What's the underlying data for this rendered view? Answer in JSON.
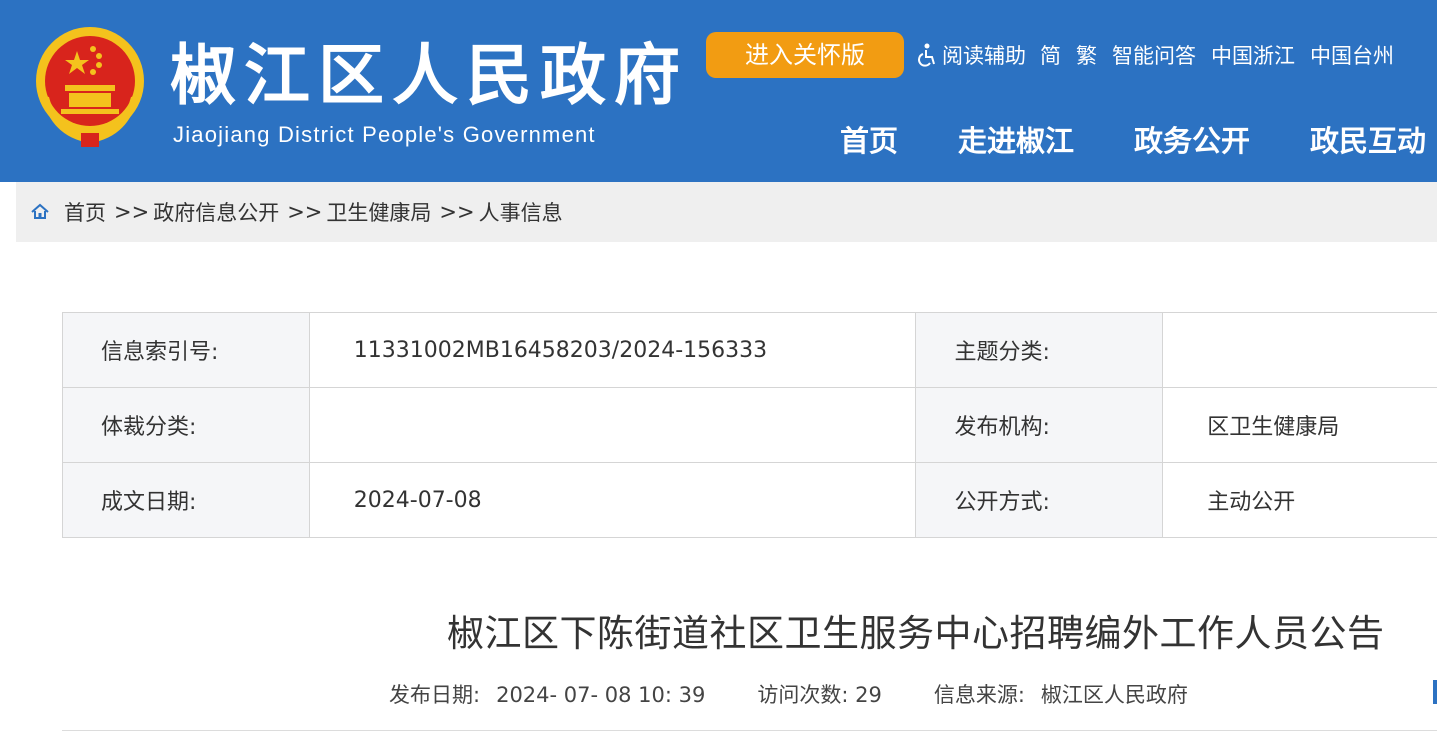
{
  "header": {
    "site_title": "椒江区人民政府",
    "site_subtitle": "Jiaojiang District People's Government",
    "care_button": "进入关怀版",
    "top_links": {
      "reading_aid": "阅读辅助",
      "simplified": "简",
      "traditional": "繁",
      "smart_qa": "智能问答",
      "china_zhejiang": "中国浙江",
      "china_taizhou": "中国台州"
    },
    "nav": [
      "首页",
      "走进椒江",
      "政务公开",
      "政民互动"
    ]
  },
  "breadcrumb": {
    "items": [
      "首页",
      "政府信息公开",
      "卫生健康局",
      "人事信息"
    ],
    "separator": ">>"
  },
  "info_table": {
    "index_no_label": "信息索引号:",
    "index_no_value": "11331002MB16458203/2024-156333",
    "topic_label": "主题分类:",
    "topic_value": "",
    "genre_label": "体裁分类:",
    "genre_value": "",
    "publisher_label": "发布机构:",
    "publisher_value": "区卫生健康局",
    "date_label": "成文日期:",
    "date_value": "2024-07-08",
    "disclosure_label": "公开方式:",
    "disclosure_value": "主动公开"
  },
  "article": {
    "title": "椒江区下陈街道社区卫生服务中心招聘编外工作人员公告",
    "publish_date_label": "发布日期:",
    "publish_date_value": "2024- 07- 08 10: 39",
    "visits_label": "访问次数:",
    "visits_value": "29",
    "source_label": "信息来源:",
    "source_value": "椒江区人民政府"
  },
  "colors": {
    "header_bg": "#2c72c2",
    "care_button_bg": "#f29c12",
    "breadcrumb_bg": "#efefef",
    "table_label_bg": "#f5f6f8",
    "emblem_red": "#d8241c",
    "emblem_gold": "#f4c21d"
  },
  "icons": {
    "emblem": "national-emblem-icon",
    "reading_aid": "accessibility-icon",
    "breadcrumb_home": "home-icon"
  }
}
